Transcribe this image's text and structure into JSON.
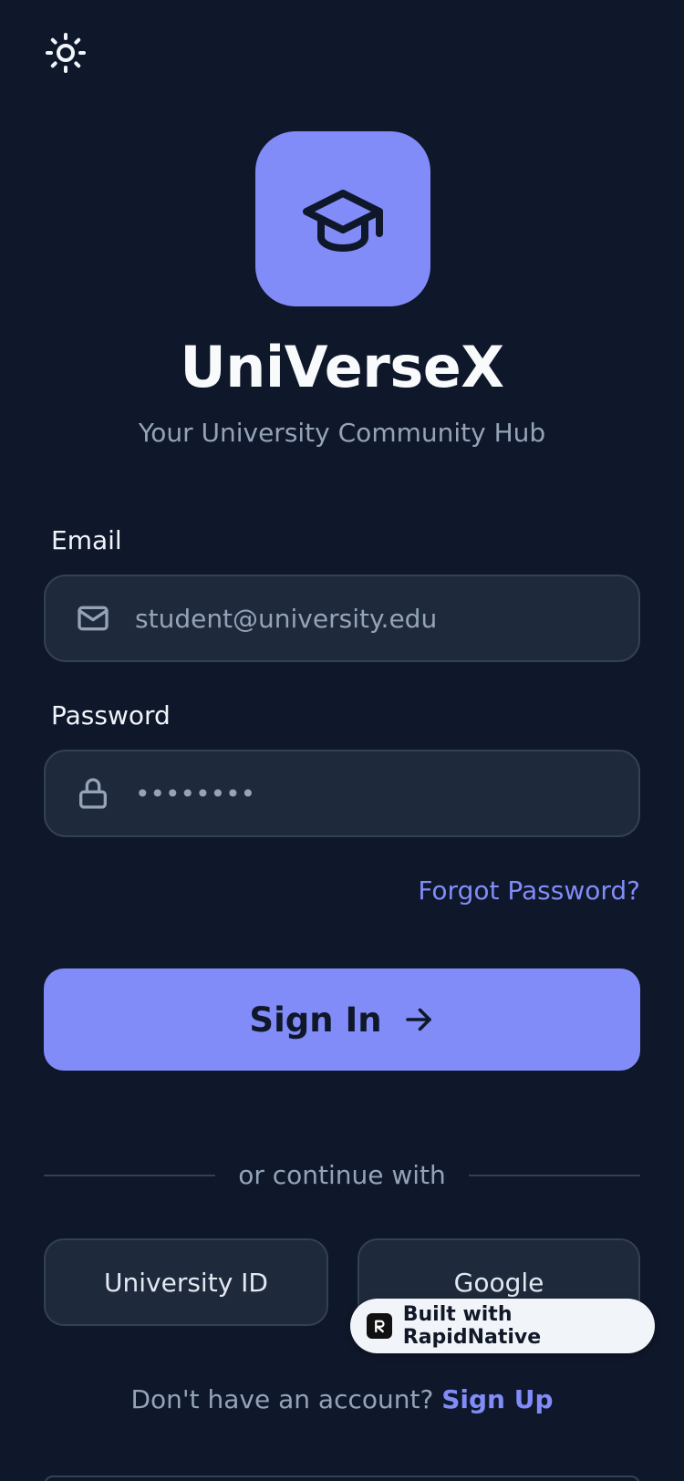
{
  "app": {
    "title": "UniVerseX",
    "subtitle": "Your University Community Hub"
  },
  "form": {
    "email_label": "Email",
    "email_value": "student@university.edu",
    "password_label": "Password",
    "password_value": "••••••••",
    "forgot_label": "Forgot Password?",
    "signin_label": "Sign In"
  },
  "alt_login": {
    "divider_text": "or continue with",
    "university_id_label": "University ID",
    "google_label": "Google"
  },
  "footer": {
    "prompt": "Don't have an account?",
    "signup_label": "Sign Up"
  },
  "badge": {
    "label": "Built with RapidNative"
  },
  "icons": {
    "theme": "sun-icon",
    "logo": "graduation-cap-icon",
    "email": "mail-icon",
    "password": "lock-icon",
    "signin": "arrow-right-icon"
  },
  "colors": {
    "background": "#0f172a",
    "accent": "#818cf8",
    "input_bg": "#1e293b",
    "muted_text": "#94a3b8"
  }
}
